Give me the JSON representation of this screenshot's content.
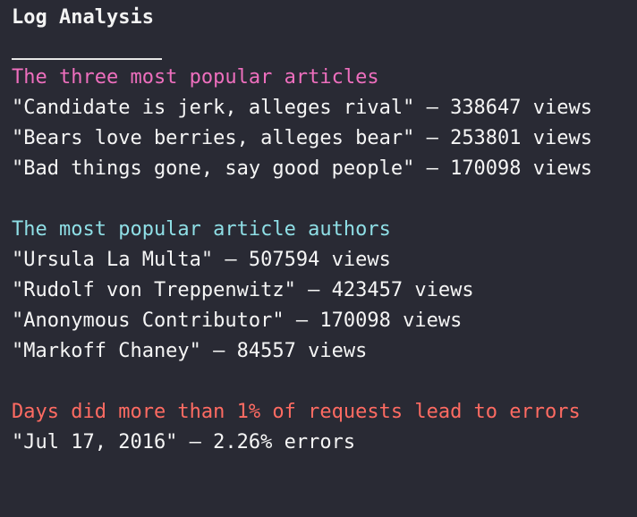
{
  "title": "Log Analysis",
  "separator": "__________",
  "colors": {
    "background": "#292a34",
    "section_popular_articles": "#ee6fbe",
    "section_popular_authors": "#8fdfe6",
    "section_errors": "#ff6b62",
    "text": "#f5f5f5"
  },
  "sections": [
    {
      "heading": "The three most popular articles",
      "lines": [
        "\"Candidate is jerk, alleges rival\" — 338647 views",
        "\"Bears love berries, alleges bear\" — 253801 views",
        "\"Bad things gone, say good people\" — 170098 views"
      ]
    },
    {
      "heading": "The most popular article authors",
      "lines": [
        "\"Ursula La Multa\" — 507594 views",
        "\"Rudolf von Treppenwitz\" — 423457 views",
        "\"Anonymous Contributor\" — 170098 views",
        "\"Markoff Chaney\" — 84557 views"
      ]
    },
    {
      "heading": "Days did more than 1% of requests lead to errors",
      "lines": [
        "\"Jul 17, 2016\" — 2.26% errors"
      ]
    }
  ]
}
